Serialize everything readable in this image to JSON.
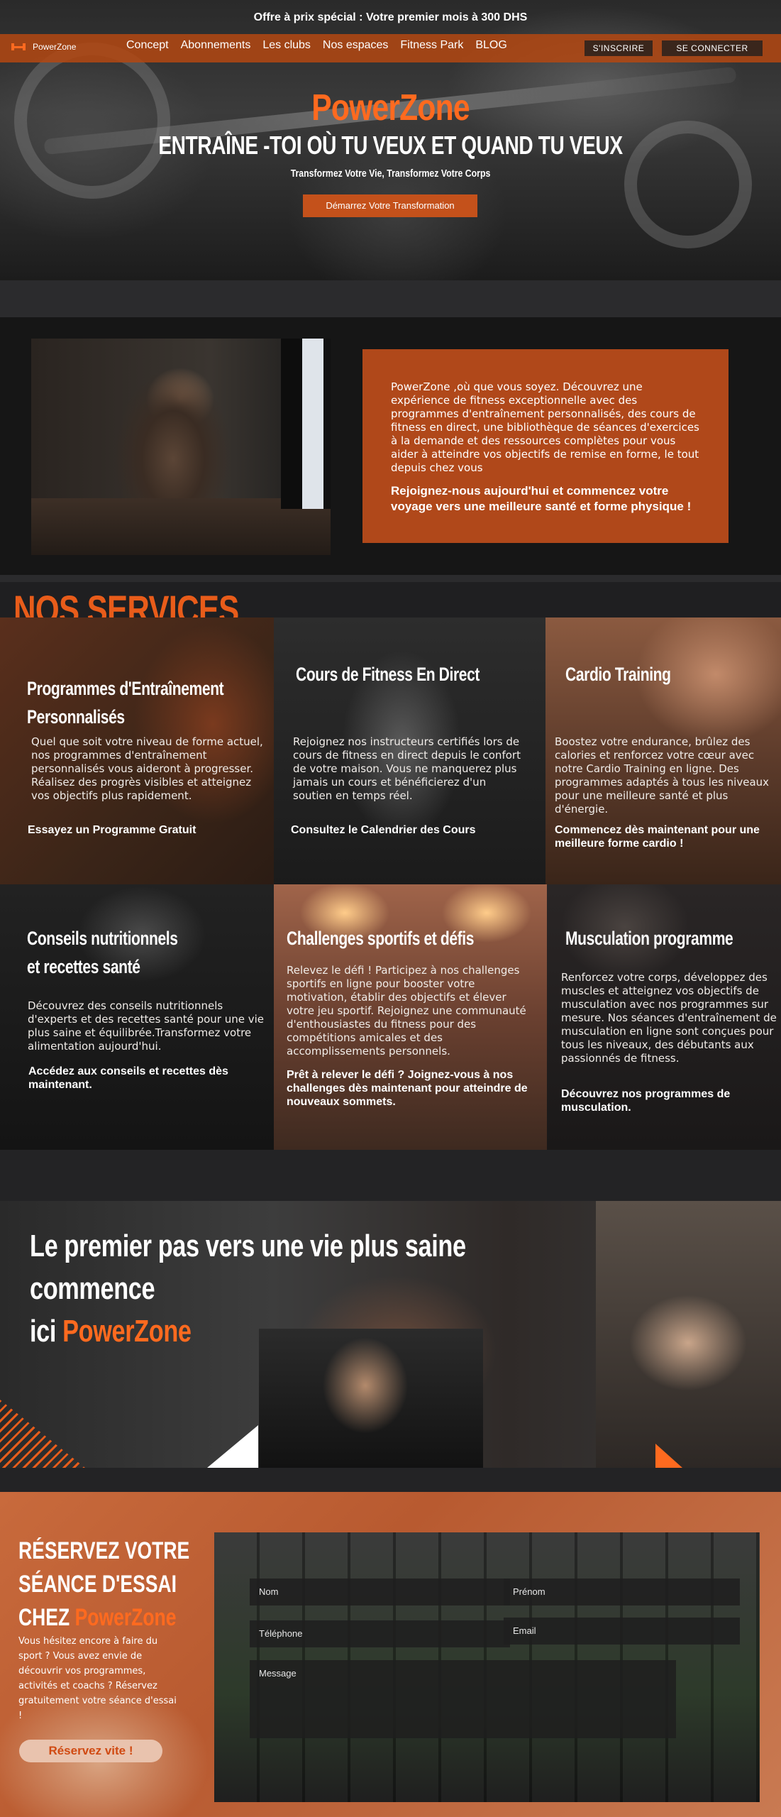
{
  "promo": "Offre à prix spécial : Votre premier mois à 300 DHS",
  "nav": {
    "logo": "PowerZone",
    "links": [
      "Concept",
      "Abonnements",
      "Les clubs",
      "Nos espaces",
      "Fitness Park",
      "BLOG"
    ],
    "signup": "S'INSCRIRE",
    "login": "SE CONNECTER"
  },
  "hero": {
    "brand": "PowerZone",
    "title": "ENTRAÎNE -TOI OÙ TU VEUX ET QUAND TU VEUX",
    "subtitle": "Transformez Votre Vie, Transformez Votre Corps",
    "cta": "Démarrez Votre Transformation"
  },
  "intro": {
    "text": "PowerZone ,où que vous soyez. Découvrez une expérience de fitness exceptionnelle avec des programmes d'entraînement personnalisés, des cours de fitness en direct, une bibliothèque de séances d'exercices à la demande et des ressources complètes pour vous aider à atteindre vos objectifs de remise en forme, le tout depuis chez vous",
    "strong": "Rejoignez-nous aujourd'hui et commencez votre voyage vers une meilleure santé et forme physique !"
  },
  "services": {
    "title": "NOS SERVICES",
    "cards": [
      {
        "title_1": "Programmes d'Entraînement",
        "title_2": "Personnalisés",
        "text": "Quel que soit votre niveau de forme actuel, nos programmes d'entraînement personnalisés vous aideront à progresser. Réalisez des progrès visibles et atteignez vos objectifs plus rapidement.",
        "cta": "Essayez un Programme Gratuit"
      },
      {
        "title_1": "Cours de Fitness En Direct",
        "text": "Rejoignez nos instructeurs certifiés lors de cours de fitness en direct depuis le confort de votre maison. Vous ne manquerez plus jamais un cours et bénéficierez d'un soutien en temps réel.",
        "cta": "Consultez le Calendrier des Cours"
      },
      {
        "title_1": "Cardio Training",
        "text": "Boostez votre endurance, brûlez des calories et renforcez votre cœur avec notre Cardio Training en ligne. Des programmes adaptés à tous les niveaux pour une meilleure santé et plus d'énergie.",
        "cta": "Commencez dès maintenant pour une meilleure forme cardio !"
      },
      {
        "title_1": "Conseils nutritionnels",
        "title_2": "et recettes santé",
        "text": "Découvrez des conseils nutritionnels d'experts et des recettes santé pour une vie plus saine et équilibrée.Transformez votre alimentation aujourd'hui.",
        "cta": "Accédez aux conseils et recettes dès maintenant."
      },
      {
        "title_1": "Challenges sportifs et défis",
        "text": "Relevez le défi ! Participez à nos challenges sportifs en ligne pour booster votre motivation, établir des objectifs et élever votre jeu sportif. Rejoignez une communauté d'enthousiastes du fitness pour des compétitions amicales et des accomplissements personnels.",
        "cta": "Prêt à relever le défi ? Joignez-vous à nos challenges dès maintenant pour atteindre de nouveaux sommets."
      },
      {
        "title_1": "Musculation programme",
        "text": "Renforcez votre corps, développez des muscles et atteignez vos objectifs de musculation avec nos programmes sur mesure. Nos séances d'entraînement de musculation en ligne sont conçues pour tous les niveaux, des débutants aux passionnés de fitness.",
        "cta": "Découvrez nos programmes de musculation."
      }
    ]
  },
  "banner": {
    "line1": "Le premier pas vers une vie plus saine commence",
    "line2": "ici",
    "brand": "PowerZone"
  },
  "booking": {
    "title_1": "RÉSERVEZ VOTRE",
    "title_2": "SÉANCE D'ESSAI",
    "title_3": "CHEZ",
    "brand": "PowerZone",
    "text": "Vous hésitez encore à faire du sport ? Vous avez envie de découvrir vos programmes, activités et coachs ? Réservez gratuitement votre séance d'essai !",
    "button": "Réservez vite !",
    "form": {
      "name": "Nom",
      "firstname": "Prénom",
      "phone": "Téléphone",
      "email": "Email",
      "message": "Message"
    }
  },
  "colors": {
    "brand_orange": "#ff6a1f",
    "nav_bg": "#b4481a",
    "box_orange": "#b0481a",
    "dark_bg": "#1e1e20"
  }
}
